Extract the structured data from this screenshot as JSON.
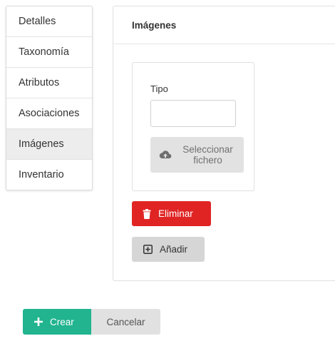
{
  "tabs": {
    "items": [
      {
        "label": "Detalles"
      },
      {
        "label": "Taxonomía"
      },
      {
        "label": "Atributos"
      },
      {
        "label": "Asociaciones"
      },
      {
        "label": "Imágenes"
      },
      {
        "label": "Inventario"
      }
    ],
    "active": "Imágenes"
  },
  "panel": {
    "title": "Imágenes",
    "image_card": {
      "type_label": "Tipo",
      "type_value": "",
      "select_file_label": "Seleccionar fichero",
      "select_file_icon": "cloud-upload-icon"
    },
    "delete_label": "Eliminar",
    "delete_icon": "trash-icon",
    "add_label": "Añadir",
    "add_icon": "plus-square-icon"
  },
  "actions": {
    "create_label": "Crear",
    "create_icon": "plus-icon",
    "cancel_label": "Cancelar"
  },
  "colors": {
    "primary": "#21b48f",
    "danger": "#e02424",
    "active_tab_bg": "#ededed"
  }
}
